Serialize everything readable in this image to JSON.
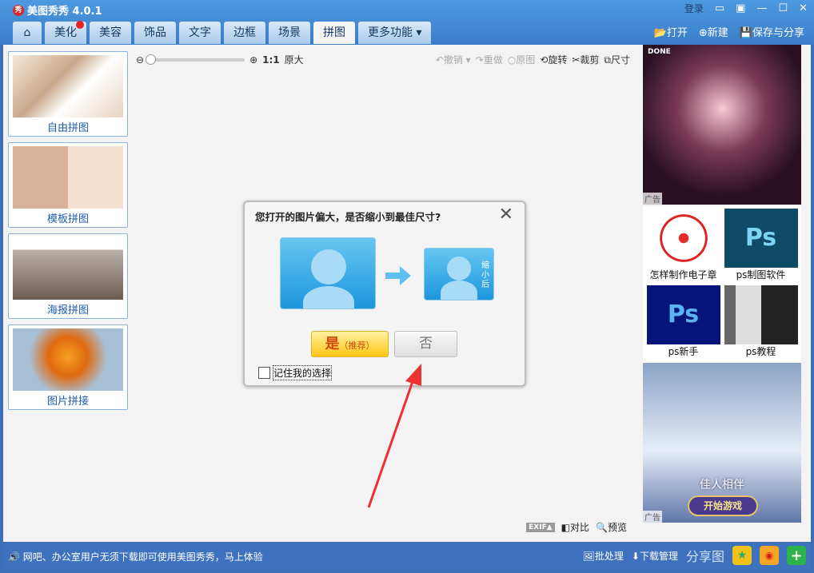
{
  "app": {
    "title": "美图秀秀 4.0.1",
    "login": "登录"
  },
  "tabs": [
    {
      "label": "美化"
    },
    {
      "label": "美容"
    },
    {
      "label": "饰品"
    },
    {
      "label": "文字"
    },
    {
      "label": "边框"
    },
    {
      "label": "场景"
    },
    {
      "label": "拼图"
    },
    {
      "label": "更多功能 ▾"
    }
  ],
  "fileops": {
    "open": "打开",
    "new": "新建",
    "save": "保存与分享"
  },
  "toolbar": {
    "ratio": "1:1",
    "original_size": "原大",
    "undo": "撤销",
    "redo": "重做",
    "original": "原图",
    "rotate": "旋转",
    "crop": "裁剪",
    "size": "尺寸",
    "exif": "EXIF▲",
    "compare": "对比",
    "preview": "预览",
    "zoom_level": 0
  },
  "left": [
    {
      "label": "自由拼图"
    },
    {
      "label": "模板拼图"
    },
    {
      "label": "海报拼图"
    },
    {
      "label": "图片拼接"
    }
  ],
  "ads": {
    "tag": "广告",
    "items": [
      {
        "label": "怎样制作电子章"
      },
      {
        "label": "ps制图软件"
      },
      {
        "label": "ps新手"
      },
      {
        "label": "ps教程"
      }
    ],
    "ad2_text": "佳人相伴",
    "ad2_button": "开始游戏",
    "ad1_text": "DONE"
  },
  "dialog": {
    "title": "您打开的图片偏大，是否缩小到最佳尺寸?",
    "after": "缩小后",
    "yes": "是",
    "yes_note": "（推荐）",
    "no": "否",
    "remember": "记住我的选择"
  },
  "status": {
    "message": "网吧、办公室用户无须下载即可使用美图秀秀，马上体验",
    "batch": "批处理",
    "downloads": "下载管理",
    "share": "分享图"
  }
}
